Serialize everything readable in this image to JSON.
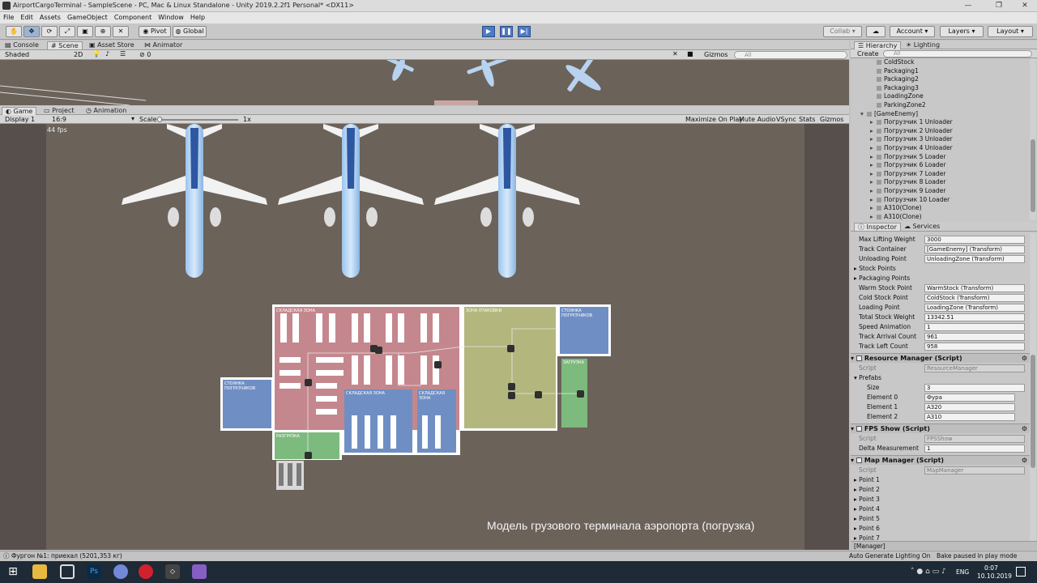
{
  "window": {
    "title": "AirportCargoTerminal - SampleScene - PC, Mac & Linux Standalone - Unity 2019.2.2f1 Personal* <DX11>"
  },
  "menu": [
    "File",
    "Edit",
    "Assets",
    "GameObject",
    "Component",
    "Window",
    "Help"
  ],
  "toolbar": {
    "pivot": "Pivot",
    "global": "Global",
    "collab": "Collab",
    "account": "Account",
    "layers": "Layers",
    "layout": "Layout"
  },
  "scene_tabs": [
    "Console",
    "Scene",
    "Asset Store",
    "Animator"
  ],
  "scene_bar": {
    "shading": "Shaded",
    "mode2d": "2D",
    "gizmos": "Gizmos",
    "search_placeholder": "All",
    "fx_count": "0"
  },
  "game_tabs": [
    "Game",
    "Project",
    "Animation"
  ],
  "game_bar": {
    "display": "Display 1",
    "aspect": "16:9",
    "scale_label": "Scale",
    "scale_value": "1x",
    "maximize": "Maximize On Play",
    "mute": "Mute Audio",
    "vsync": "VSync",
    "stats": "Stats",
    "gizmos": "Gizmos"
  },
  "game": {
    "fps": "44 fps",
    "caption": "Модель грузового терминала аэропорта (погрузка)",
    "zones": {
      "sorting": "СКЛАДСКАЯ ЗОНА",
      "packaging": "ЗОНА УПАКОВКИ",
      "parking_top": "СТОЯНКА ПОГРУЗЧИКОВ",
      "parking_left": "СТОЯНКА ПОГРУЗЧИКОВ",
      "warm": "СКЛАДСКАЯ ЗОНА",
      "cold": "СКЛАДСКАЯ ЗОНА",
      "loading": "ЗАГРУЗКА",
      "unloading": "РАЗГРУЗКА"
    }
  },
  "hierarchy": {
    "tabs": [
      "Hierarchy",
      "Lighting"
    ],
    "create": "Create",
    "search_placeholder": "All",
    "items": [
      {
        "label": "ColdStock",
        "indent": 2,
        "arrow": false
      },
      {
        "label": "Packaging1",
        "indent": 2,
        "arrow": false
      },
      {
        "label": "Packaging2",
        "indent": 2,
        "arrow": false
      },
      {
        "label": "Packaging3",
        "indent": 2,
        "arrow": false
      },
      {
        "label": "LoadingZone",
        "indent": 2,
        "arrow": false
      },
      {
        "label": "ParkingZone2",
        "indent": 2,
        "arrow": false
      },
      {
        "label": "[GameEnemy]",
        "indent": 1,
        "arrow": true
      },
      {
        "label": "Погрузчик 1 Unloader",
        "indent": 2,
        "arrow": true
      },
      {
        "label": "Погрузчик 2 Unloader",
        "indent": 2,
        "arrow": true
      },
      {
        "label": "Погрузчик 3 Unloader",
        "indent": 2,
        "arrow": true
      },
      {
        "label": "Погрузчик 4 Unloader",
        "indent": 2,
        "arrow": true
      },
      {
        "label": "Погрузчик 5 Loader",
        "indent": 2,
        "arrow": true
      },
      {
        "label": "Погрузчик 6 Loader",
        "indent": 2,
        "arrow": true
      },
      {
        "label": "Погрузчик 7 Loader",
        "indent": 2,
        "arrow": true
      },
      {
        "label": "Погрузчик 8 Loader",
        "indent": 2,
        "arrow": true
      },
      {
        "label": "Погрузчик 9 Loader",
        "indent": 2,
        "arrow": true
      },
      {
        "label": "Погрузчик 10 Loader",
        "indent": 2,
        "arrow": true
      },
      {
        "label": "A310(Clone)",
        "indent": 2,
        "arrow": true
      },
      {
        "label": "A310(Clone)",
        "indent": 2,
        "arrow": true
      }
    ]
  },
  "inspector": {
    "tabs": [
      "Inspector",
      "Services"
    ],
    "fields": [
      {
        "label": "Max Lifting Weight",
        "value": "3000"
      },
      {
        "label": "Track Container",
        "value": "[GameEnemy] (Transform)"
      },
      {
        "label": "Unloading Point",
        "value": "UnloadingZone (Transform)"
      },
      {
        "label": "Stock Points",
        "value": ""
      },
      {
        "label": "Packaging Points",
        "value": ""
      },
      {
        "label": "Warm Stock Point",
        "value": "WarmStock (Transform)"
      },
      {
        "label": "Cold Stock Point",
        "value": "ColdStock (Transform)"
      },
      {
        "label": "Loading Point",
        "value": "LoadingZone (Transform)"
      },
      {
        "label": "Total Stock Weight",
        "value": "13342.51"
      },
      {
        "label": "Speed Animation",
        "value": "1"
      },
      {
        "label": "Track Arrival Count",
        "value": "961"
      },
      {
        "label": "Track Left Count",
        "value": "958"
      }
    ],
    "resource_manager": {
      "title": "Resource Manager (Script)",
      "script_label": "Script",
      "script": "ResourceManager",
      "prefabs": "Prefabs",
      "size_label": "Size",
      "size": "3",
      "elements": [
        {
          "label": "Element 0",
          "value": "Фура"
        },
        {
          "label": "Element 1",
          "value": "A320"
        },
        {
          "label": "Element 2",
          "value": "A310"
        }
      ]
    },
    "fps_show": {
      "title": "FPS Show (Script)",
      "script_label": "Script",
      "script": "FPSShow",
      "delta_label": "Delta Measurement",
      "delta": "1"
    },
    "map_manager": {
      "title": "Map Manager (Script)",
      "script_label": "Script",
      "script": "MapManager",
      "points": [
        "Point 1",
        "Point 2",
        "Point 3",
        "Point 4",
        "Point 5",
        "Point 6",
        "Point 7"
      ]
    },
    "footer": "[Manager]"
  },
  "status": {
    "message": "Фургон №1: приехал (5201,353 кг)",
    "lighting": "Auto Generate Lighting On",
    "bake": "Bake paused in play mode"
  },
  "taskbar": {
    "lang": "ENG",
    "time": "0:07",
    "date": "10.10.2019"
  }
}
